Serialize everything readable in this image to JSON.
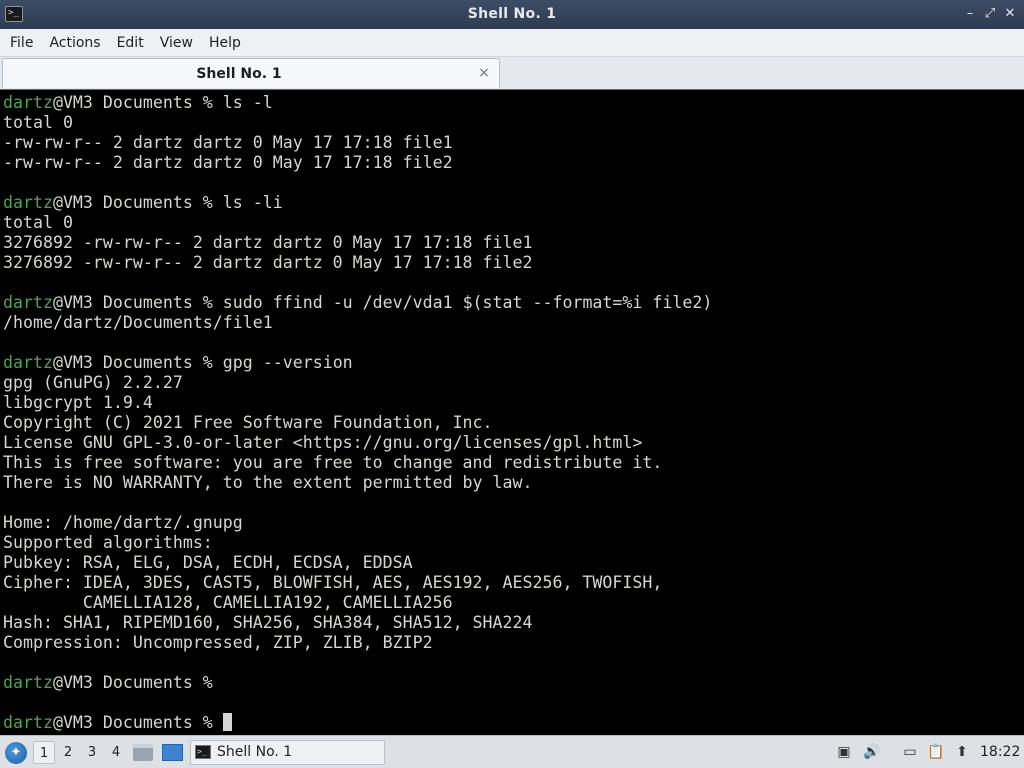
{
  "window": {
    "title": "Shell No. 1",
    "app_icon_glyph": ">_",
    "controls": {
      "minimize": "–",
      "restore": "⤢",
      "close": "✕"
    }
  },
  "menubar": {
    "items": [
      "File",
      "Actions",
      "Edit",
      "View",
      "Help"
    ]
  },
  "tabs": [
    {
      "label": "Shell No. 1",
      "close": "×"
    }
  ],
  "terminal": {
    "prompt_user": "dartz",
    "prompt_rest": "@VM3 Documents % ",
    "lines": [
      {
        "type": "prompt",
        "cmd": "ls -l"
      },
      {
        "type": "out",
        "text": "total 0"
      },
      {
        "type": "out",
        "text": "-rw-rw-r-- 2 dartz dartz 0 May 17 17:18 file1"
      },
      {
        "type": "out",
        "text": "-rw-rw-r-- 2 dartz dartz 0 May 17 17:18 file2"
      },
      {
        "type": "out",
        "text": ""
      },
      {
        "type": "prompt",
        "cmd": "ls -li"
      },
      {
        "type": "out",
        "text": "total 0"
      },
      {
        "type": "out",
        "text": "3276892 -rw-rw-r-- 2 dartz dartz 0 May 17 17:18 file1"
      },
      {
        "type": "out",
        "text": "3276892 -rw-rw-r-- 2 dartz dartz 0 May 17 17:18 file2"
      },
      {
        "type": "out",
        "text": ""
      },
      {
        "type": "prompt",
        "cmd": "sudo ffind -u /dev/vda1 $(stat --format=%i file2)"
      },
      {
        "type": "out",
        "text": "/home/dartz/Documents/file1"
      },
      {
        "type": "out",
        "text": ""
      },
      {
        "type": "prompt",
        "cmd": "gpg --version"
      },
      {
        "type": "out",
        "text": "gpg (GnuPG) 2.2.27"
      },
      {
        "type": "out",
        "text": "libgcrypt 1.9.4"
      },
      {
        "type": "out",
        "text": "Copyright (C) 2021 Free Software Foundation, Inc."
      },
      {
        "type": "out",
        "text": "License GNU GPL-3.0-or-later <https://gnu.org/licenses/gpl.html>"
      },
      {
        "type": "out",
        "text": "This is free software: you are free to change and redistribute it."
      },
      {
        "type": "out",
        "text": "There is NO WARRANTY, to the extent permitted by law."
      },
      {
        "type": "out",
        "text": ""
      },
      {
        "type": "out",
        "text": "Home: /home/dartz/.gnupg"
      },
      {
        "type": "out",
        "text": "Supported algorithms:"
      },
      {
        "type": "out",
        "text": "Pubkey: RSA, ELG, DSA, ECDH, ECDSA, EDDSA"
      },
      {
        "type": "out",
        "text": "Cipher: IDEA, 3DES, CAST5, BLOWFISH, AES, AES192, AES256, TWOFISH,"
      },
      {
        "type": "out",
        "text": "        CAMELLIA128, CAMELLIA192, CAMELLIA256"
      },
      {
        "type": "out",
        "text": "Hash: SHA1, RIPEMD160, SHA256, SHA384, SHA512, SHA224"
      },
      {
        "type": "out",
        "text": "Compression: Uncompressed, ZIP, ZLIB, BZIP2"
      },
      {
        "type": "out",
        "text": ""
      },
      {
        "type": "prompt",
        "cmd": ""
      },
      {
        "type": "out",
        "text": ""
      },
      {
        "type": "prompt",
        "cmd": "",
        "cursor": true
      }
    ]
  },
  "taskbar": {
    "workspaces": [
      "1",
      "2",
      "3",
      "4"
    ],
    "active_workspace": "1",
    "task_label": "Shell No. 1",
    "clock": "18:22",
    "colors": {
      "prompt_user": "#4ea54e",
      "terminal_bg": "#000000",
      "terminal_fg": "#d3d7cf",
      "titlebar": "#34425a"
    }
  }
}
